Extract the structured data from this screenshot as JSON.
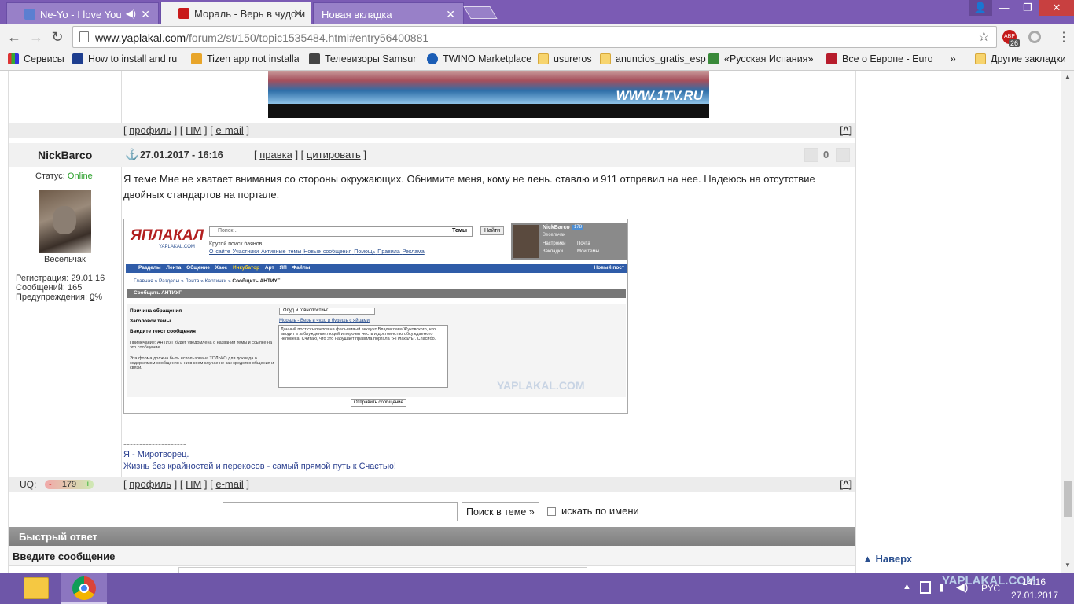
{
  "tabs": [
    {
      "title": "Ne-Yo - I love You",
      "icon": "youtube-icon",
      "active": false
    },
    {
      "title": "Мораль - Верь в чудо и",
      "icon": "yaplakal-icon",
      "active": true
    },
    {
      "title": "Новая вкладка",
      "icon": "",
      "active": false
    }
  ],
  "omnibox": {
    "host": "www.yaplakal.com",
    "path": "/forum2/st/150/topic1535484.html#entry56400881"
  },
  "adblock_badge": "26",
  "bookmarks": [
    {
      "label": "Сервисы",
      "icon": "apps-icon"
    },
    {
      "label": "How to install and ru",
      "icon": "bookmark-icon"
    },
    {
      "label": "Tizen app not installa",
      "icon": "bookmark-icon"
    },
    {
      "label": "Телевизоры Samsung",
      "icon": "bookmark-icon"
    },
    {
      "label": "TWINO Marketplace",
      "icon": "bookmark-icon"
    },
    {
      "label": "usureros",
      "icon": "folder-icon"
    },
    {
      "label": "anuncios_gratis_esp",
      "icon": "folder-icon"
    },
    {
      "label": "«Русская Испания» в",
      "icon": "bookmark-icon"
    },
    {
      "label": "Все о Европе - Europ",
      "icon": "bookmark-icon"
    },
    {
      "label": "»",
      "icon": ""
    },
    {
      "label": "Другие закладки",
      "icon": "folder-icon"
    }
  ],
  "prev_post": {
    "links": [
      "профиль",
      "ПМ",
      "e-mail"
    ],
    "up": "^",
    "tv_logo": "WWW.1TV.RU"
  },
  "post": {
    "author": "NickBarco",
    "date": "27.01.2017 - 16:16",
    "actions": [
      "правка",
      "цитировать"
    ],
    "rating": "0",
    "status_label": "Статус:",
    "status_value": "Online",
    "rank": "Весельчак",
    "reg": "Регистрация: 29.01.16",
    "msgs": "Сообщений: 165",
    "warn_label": "Предупреждения:",
    "warn_value": "0",
    "warn_pct": "%",
    "text": "Я теме Мне не хватает внимания со стороны окружающих. Обнимите меня, кому не лень. ставлю и 911 отправил на нее. Надеюсь на отсутствие двойных стандартов на портале.",
    "sig_line": "--------------------",
    "sig1": "Я - Миротворец.",
    "sig2": "Жизнь без крайностей и перекосов - самый прямой путь к Счастью!",
    "uq_label": "UQ:",
    "uq_value": "179",
    "uq_minus": "-",
    "uq_plus": "+",
    "links": [
      "профиль",
      "ПМ",
      "e-mail"
    ],
    "up": "^"
  },
  "shot": {
    "logo": "ЯПЛАКАЛ",
    "logo_sub": "YAPLAKAL.COM",
    "search_ph": "Поиск...",
    "search_sel": "Темы",
    "search_btn": "Найти",
    "tagline": "Крутой поиск баянов",
    "toplinks": [
      "О сайте",
      "Участники",
      "Активные темы",
      "Новые сообщения",
      "Помощь",
      "Правила",
      "Реклама"
    ],
    "user": "NickBarco",
    "user_badge": "178",
    "user_rank": "Весельчак",
    "user_links": [
      "Настройки",
      "Почта",
      "Закладки",
      "Мои темы"
    ],
    "nav": [
      "Разделы",
      "Лента",
      "Общение",
      "Хаос",
      "Инкубатор",
      "Арт",
      "ЯП Файлы"
    ],
    "newpost": "Новый пост",
    "crumbs": [
      "Главная",
      "Разделы",
      "Лента",
      "Картинки",
      "Сообщить АНТИУГ"
    ],
    "section": "Сообщить АНТИУГ",
    "f1_label": "Причина обращения",
    "f1_value": "Флуд и говнопостинг",
    "f2_label": "Заголовок темы",
    "f2_value": "Мораль - Верь в чудо и будешь с яйцами",
    "f3_label": "Введите текст сообщения",
    "note1": "Примечание: АНТИУГ будет уведомлена о названии темы и ссылке на это сообщение.",
    "note2": "Эта форма должна быть использована ТОЛЬКО для доклада о содержимом сообщения и ни в коем случае не как средство общения и связи.",
    "msg": "Данный пост ссылается на фальшивый аккаунт Владислава Жуковского, что вводит в заблуждение людей и порочит честь и достоинство обсуждаемого человека. Считаю, что это нарушает правила портала \"ЯПлакалъ\". Спасибо.",
    "watermark": "YAPLAKAL.COM",
    "submit": "Отправить сообщение"
  },
  "search": {
    "button": "Поиск в теме »",
    "checkbox_label": "искать по имени"
  },
  "quick_reply": {
    "title": "Быстрый ответ",
    "subtitle": "Введите сообщение"
  },
  "to_top": "Наверх",
  "taskbar": {
    "lang": "РУС",
    "time": "14:16",
    "date": "27.01.2017",
    "watermark": "YAPLAKAL.COM"
  },
  "colors": {
    "titlebar": "#7b5bb4",
    "online": "#2aa02a",
    "taskbar": "#6e56a8"
  }
}
